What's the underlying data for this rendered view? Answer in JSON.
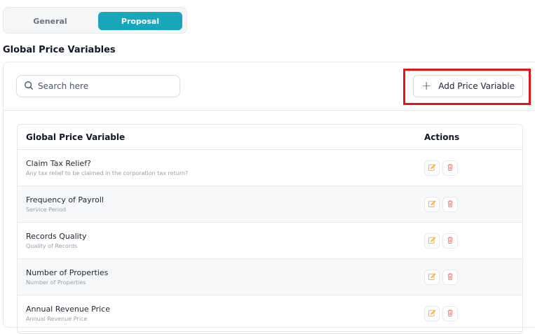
{
  "tabs": {
    "general": "General",
    "proposal": "Proposal",
    "active": "Proposal"
  },
  "section": {
    "title": "Global Price Variables"
  },
  "search": {
    "placeholder": "Search here"
  },
  "toolbar": {
    "add_label": "Add Price Variable"
  },
  "table": {
    "headers": {
      "name": "Global Price Variable",
      "actions": "Actions"
    },
    "rows": [
      {
        "title": "Claim Tax Relief?",
        "subtitle": "Any tax relief to be claimed in the corporation tax return?"
      },
      {
        "title": "Frequency of Payroll",
        "subtitle": "Service Period"
      },
      {
        "title": "Records Quality",
        "subtitle": "Quality of Records"
      },
      {
        "title": "Number of Properties",
        "subtitle": "Number of Properties"
      },
      {
        "title": "Annual Revenue Price",
        "subtitle": "Annual Revenue Price"
      }
    ]
  },
  "colors": {
    "accent": "#17a6ba",
    "highlight": "#e3161b",
    "edit_icon": "#f0b64a",
    "delete_icon": "#f08a8a"
  },
  "icons": {
    "search": "search-icon",
    "add": "plus-icon",
    "edit": "edit-icon",
    "delete": "trash-icon"
  }
}
